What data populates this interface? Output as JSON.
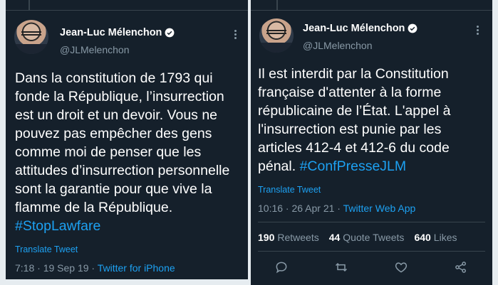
{
  "left_tweet": {
    "author_name": "Jean-Luc Mélenchon",
    "handle": "@JLMelenchon",
    "text": "Dans la constitution de 1793 qui fonde la République, l’insurrection est un droit et un devoir. Vous ne pouvez pas empêcher des gens comme moi de penser que les attitudes d’insurrection personnelle sont la garantie pour que vive la flamme de la République. ",
    "hashtag": "#StopLawfare",
    "translate": "Translate Tweet",
    "time": "7:18 · 19 Sep 19 · ",
    "app": "Twitter for iPhone"
  },
  "right_tweet": {
    "author_name": "Jean-Luc Mélenchon",
    "handle": "@JLMelenchon",
    "text": "Il est interdit par la Constitution française d'attenter à la forme républicaine de l’État. L'appel à l'insurrection est punie par les articles 412-4 et 412-6 du code pénal. ",
    "hashtag": "#ConfPresseJLM",
    "translate": "Translate Tweet",
    "time": "10:16 · 26 Apr 21 · ",
    "app": "Twitter Web App",
    "retweets_count": "190",
    "retweets_label": "Retweets",
    "quote_count": "44",
    "quote_label": "Quote Tweets",
    "likes_count": "640",
    "likes_label": "Likes"
  },
  "icons": {
    "verified": "verified-badge-icon",
    "more": "more-options-icon",
    "reply": "reply-icon",
    "retweet": "retweet-icon",
    "like": "heart-icon",
    "share": "share-icon"
  },
  "colors": {
    "background": "#15202b",
    "accent": "#1da1f2",
    "muted": "#8899a6"
  }
}
